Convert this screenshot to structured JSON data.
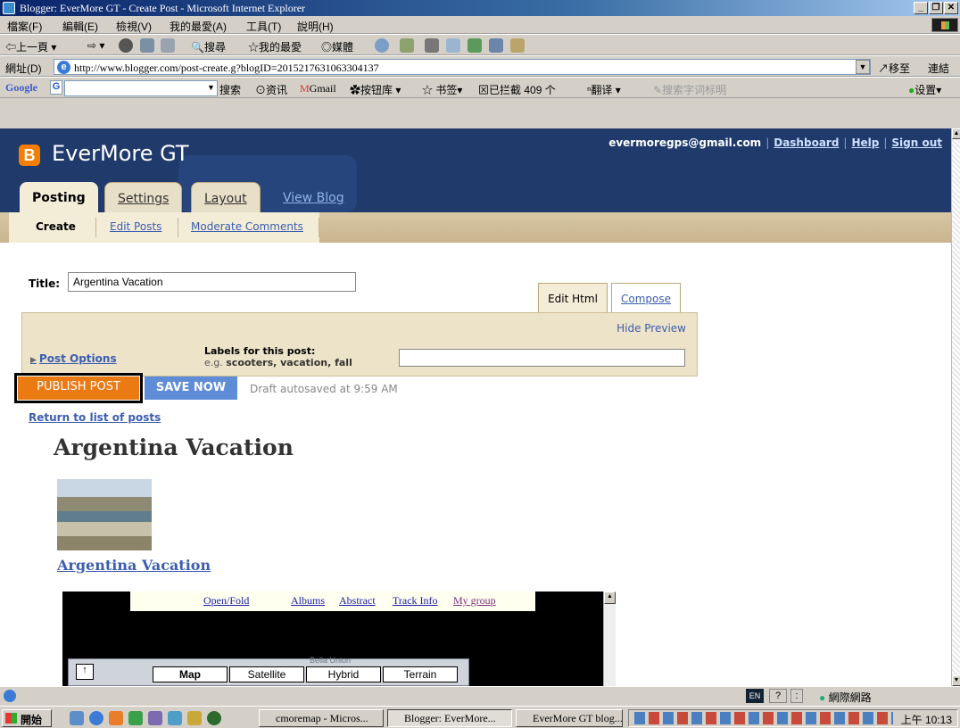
{
  "window": {
    "title": "Blogger: EverMore GT - Create Post - Microsoft Internet Explorer",
    "buttons": [
      "_",
      "̸",
      "X"
    ]
  },
  "menu": [
    "檔案(F)",
    "編輯(E)",
    "檢視(V)",
    "我的最愛(A)",
    "工具(T)",
    "說明(H)"
  ],
  "toolbar": {
    "back": "上一頁",
    "search": "搜尋",
    "favorites": "我的最愛",
    "media": "媒體"
  },
  "address": {
    "label": "網址(D)",
    "url": "http://www.blogger.com/post-create.g?blogID=2015217631063304137",
    "go": "移至",
    "links": "連結"
  },
  "google_toolbar": {
    "search": "搜索",
    "news": "资讯",
    "gmail": "Gmail",
    "buttons": "按钮库",
    "bookmarks": "书签",
    "blocked": "已拦截 409 个",
    "translate": "翻译",
    "highlight": "搜索字词标明",
    "settings": "设置"
  },
  "blogger": {
    "blog_name": "EverMore GT",
    "email": "evermoregps@gmail.com",
    "links": [
      "Dashboard",
      "Help",
      "Sign out"
    ],
    "tabs": [
      "Posting",
      "Settings",
      "Layout",
      "View Blog"
    ],
    "subtabs": [
      "Create",
      "Edit Posts",
      "Moderate Comments"
    ],
    "title_label": "Title:",
    "title_value": "Argentina Vacation",
    "mode_tabs": [
      "Edit Html",
      "Compose"
    ],
    "hide_preview": "Hide Preview",
    "post_options": "Post Options",
    "labels_title": "Labels for this post:",
    "labels_hint_prefix": "e.g.",
    "labels_hint": "scooters, vacation, fall",
    "publish": "PUBLISH POST",
    "save": "SAVE NOW",
    "autosave": "Draft autosaved at 9:59 AM",
    "return_link": "Return to list of posts",
    "post_heading": "Argentina Vacation",
    "photo_link": "Argentina Vacation"
  },
  "map_embed": {
    "nav": [
      "Open/Fold",
      "Albums",
      "Abstract",
      "Track Info",
      "My group"
    ],
    "buttons": [
      "Map",
      "Satellite",
      "Hybrid",
      "Terrain"
    ],
    "place": "Bella Union"
  },
  "status": {
    "zone": "網際網路",
    "lang": "EN"
  },
  "taskbar": {
    "start": "開始",
    "tasks": [
      "cmoremap - Micros...",
      "Blogger: EverMore...",
      "EverMore GT blog..."
    ],
    "clock": "上午 10:13"
  }
}
